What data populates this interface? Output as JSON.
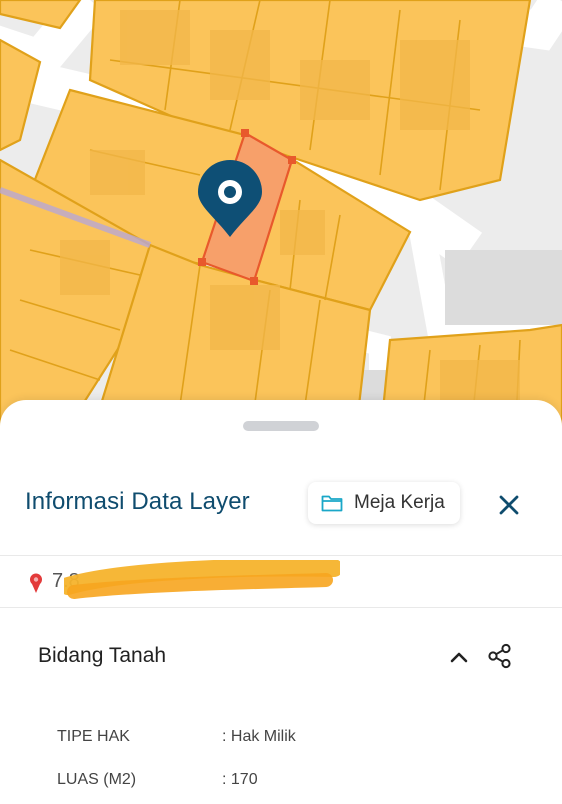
{
  "map": {
    "colors": {
      "parcel": "#fbc45a",
      "parcel_border": "#e0a11a",
      "selected": "#f7a06a",
      "selected_border": "#e8592c",
      "marker": "#0e4f75",
      "road": "#ffffff",
      "ground": "#ececec"
    },
    "marker_icon": "map-pin-icon"
  },
  "sheet": {
    "title": "Informasi Data Layer",
    "workspace_button": {
      "label": "Meja Kerja",
      "icon": "folder-icon"
    },
    "close_icon": "close-icon",
    "location": {
      "icon": "location-pin-icon",
      "coordinates_visible_prefix": "7.8",
      "redacted": true
    },
    "section": {
      "title": "Bidang Tanah",
      "collapse_icon": "chevron-up-icon",
      "share_icon": "share-icon",
      "properties": [
        {
          "label": "TIPE HAK",
          "value": ": Hak Milik"
        },
        {
          "label": "LUAS (M2)",
          "value": ": 170"
        }
      ]
    }
  }
}
